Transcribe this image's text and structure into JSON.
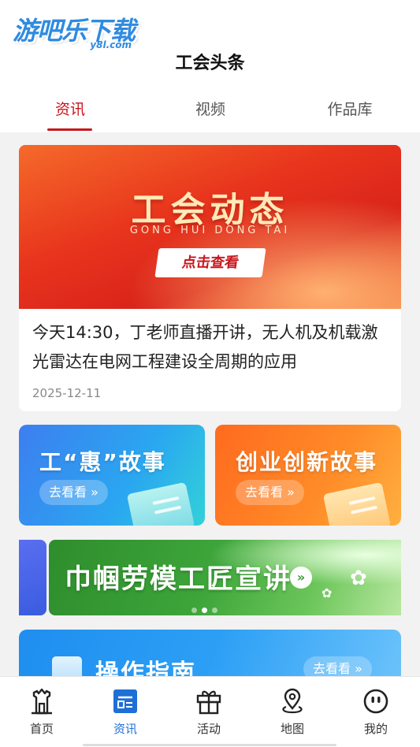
{
  "watermark": {
    "main": "游吧乐下载",
    "sub": "y8l.com"
  },
  "page_title": "工会头条",
  "tabs": [
    {
      "label": "资讯",
      "active": true
    },
    {
      "label": "视频",
      "active": false
    },
    {
      "label": "作品库",
      "active": false
    }
  ],
  "feature": {
    "banner_title": "工会动态",
    "banner_subtitle": "GONG HUI DONG TAI",
    "banner_button": "点击查看",
    "text": "今天14:30，丁老师直播开讲，无人机及机载激光雷达在电网工程建设全周期的应用",
    "date": "2025-12-11"
  },
  "cards": [
    {
      "title": "工“惠”故事",
      "button": "去看看 »"
    },
    {
      "title": "创业创新故事",
      "button": "去看看 »"
    }
  ],
  "carousel": {
    "title": "巾帼劳模工匠宣讲",
    "arrow": "»",
    "slide_count": 3,
    "active_index": 1
  },
  "guide": {
    "title": "操作指南",
    "button": "去看看 »"
  },
  "bottom_nav": [
    {
      "label": "首页",
      "icon": "home-tower-icon",
      "active": false
    },
    {
      "label": "资讯",
      "icon": "news-icon",
      "active": true
    },
    {
      "label": "活动",
      "icon": "gift-icon",
      "active": false
    },
    {
      "label": "地图",
      "icon": "map-pin-icon",
      "active": false
    },
    {
      "label": "我的",
      "icon": "profile-face-icon",
      "active": false
    }
  ],
  "colors": {
    "primary_red": "#c8161d",
    "nav_active_blue": "#1e6fd6"
  }
}
